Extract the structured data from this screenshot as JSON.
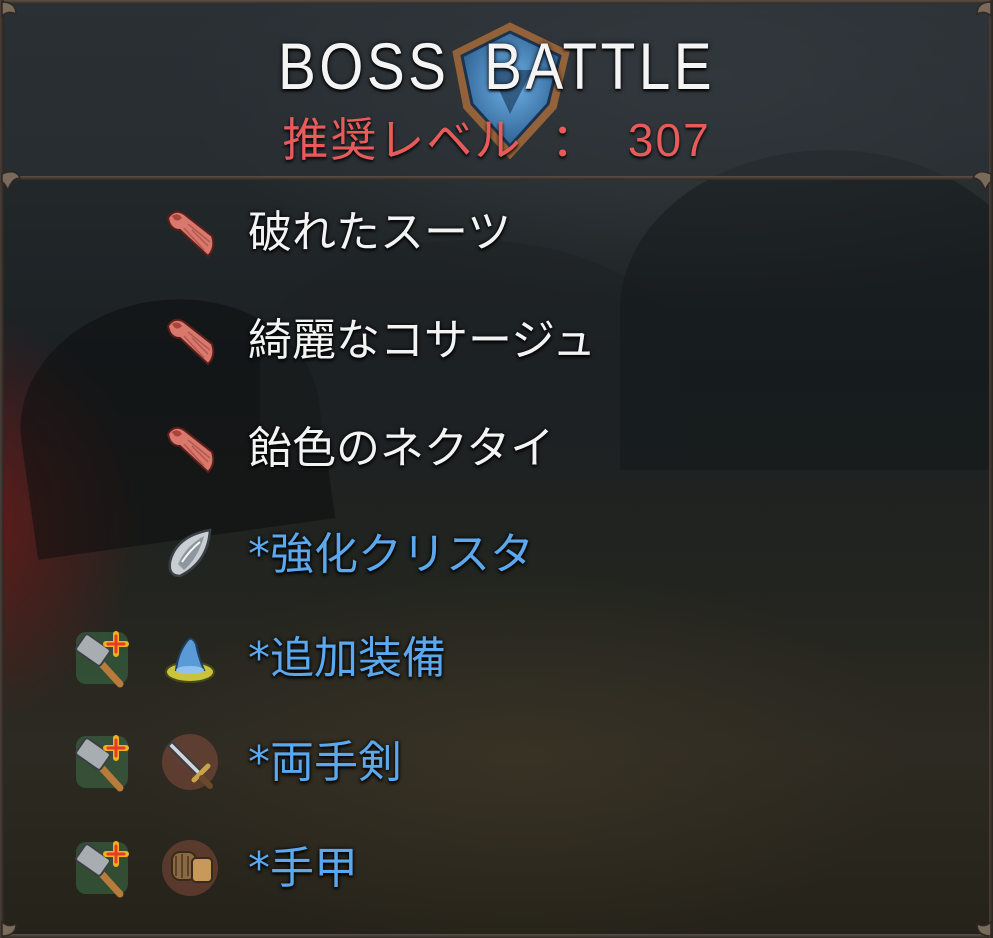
{
  "header": {
    "title": "BOSS  BATTLE",
    "recommended_level_label": "推奨レベル",
    "separator": "：",
    "recommended_level_value": "307"
  },
  "rewards": [
    {
      "label": "破れたスーツ",
      "icon": "red-cloth-icon",
      "color": "white",
      "upgrade_badge": false
    },
    {
      "label": "綺麗なコサージュ",
      "icon": "red-cloth-icon",
      "color": "white",
      "upgrade_badge": false
    },
    {
      "label": "飴色のネクタイ",
      "icon": "red-cloth-icon",
      "color": "white",
      "upgrade_badge": false
    },
    {
      "label": "*強化クリスタ",
      "icon": "crystal-icon",
      "color": "blue",
      "upgrade_badge": false
    },
    {
      "label": "*追加装備",
      "icon": "wizard-hat-icon",
      "color": "blue",
      "upgrade_badge": true
    },
    {
      "label": "*両手剣",
      "icon": "sword-icon",
      "color": "blue",
      "upgrade_badge": true
    },
    {
      "label": "*手甲",
      "icon": "gauntlet-icon",
      "color": "blue",
      "upgrade_badge": true
    }
  ],
  "colors": {
    "title": "#f4f4f4",
    "level": "#e85b5b",
    "material_text": "#f3f3f3",
    "equipment_text": "#5ba8ee",
    "frame": "#5c5148"
  }
}
